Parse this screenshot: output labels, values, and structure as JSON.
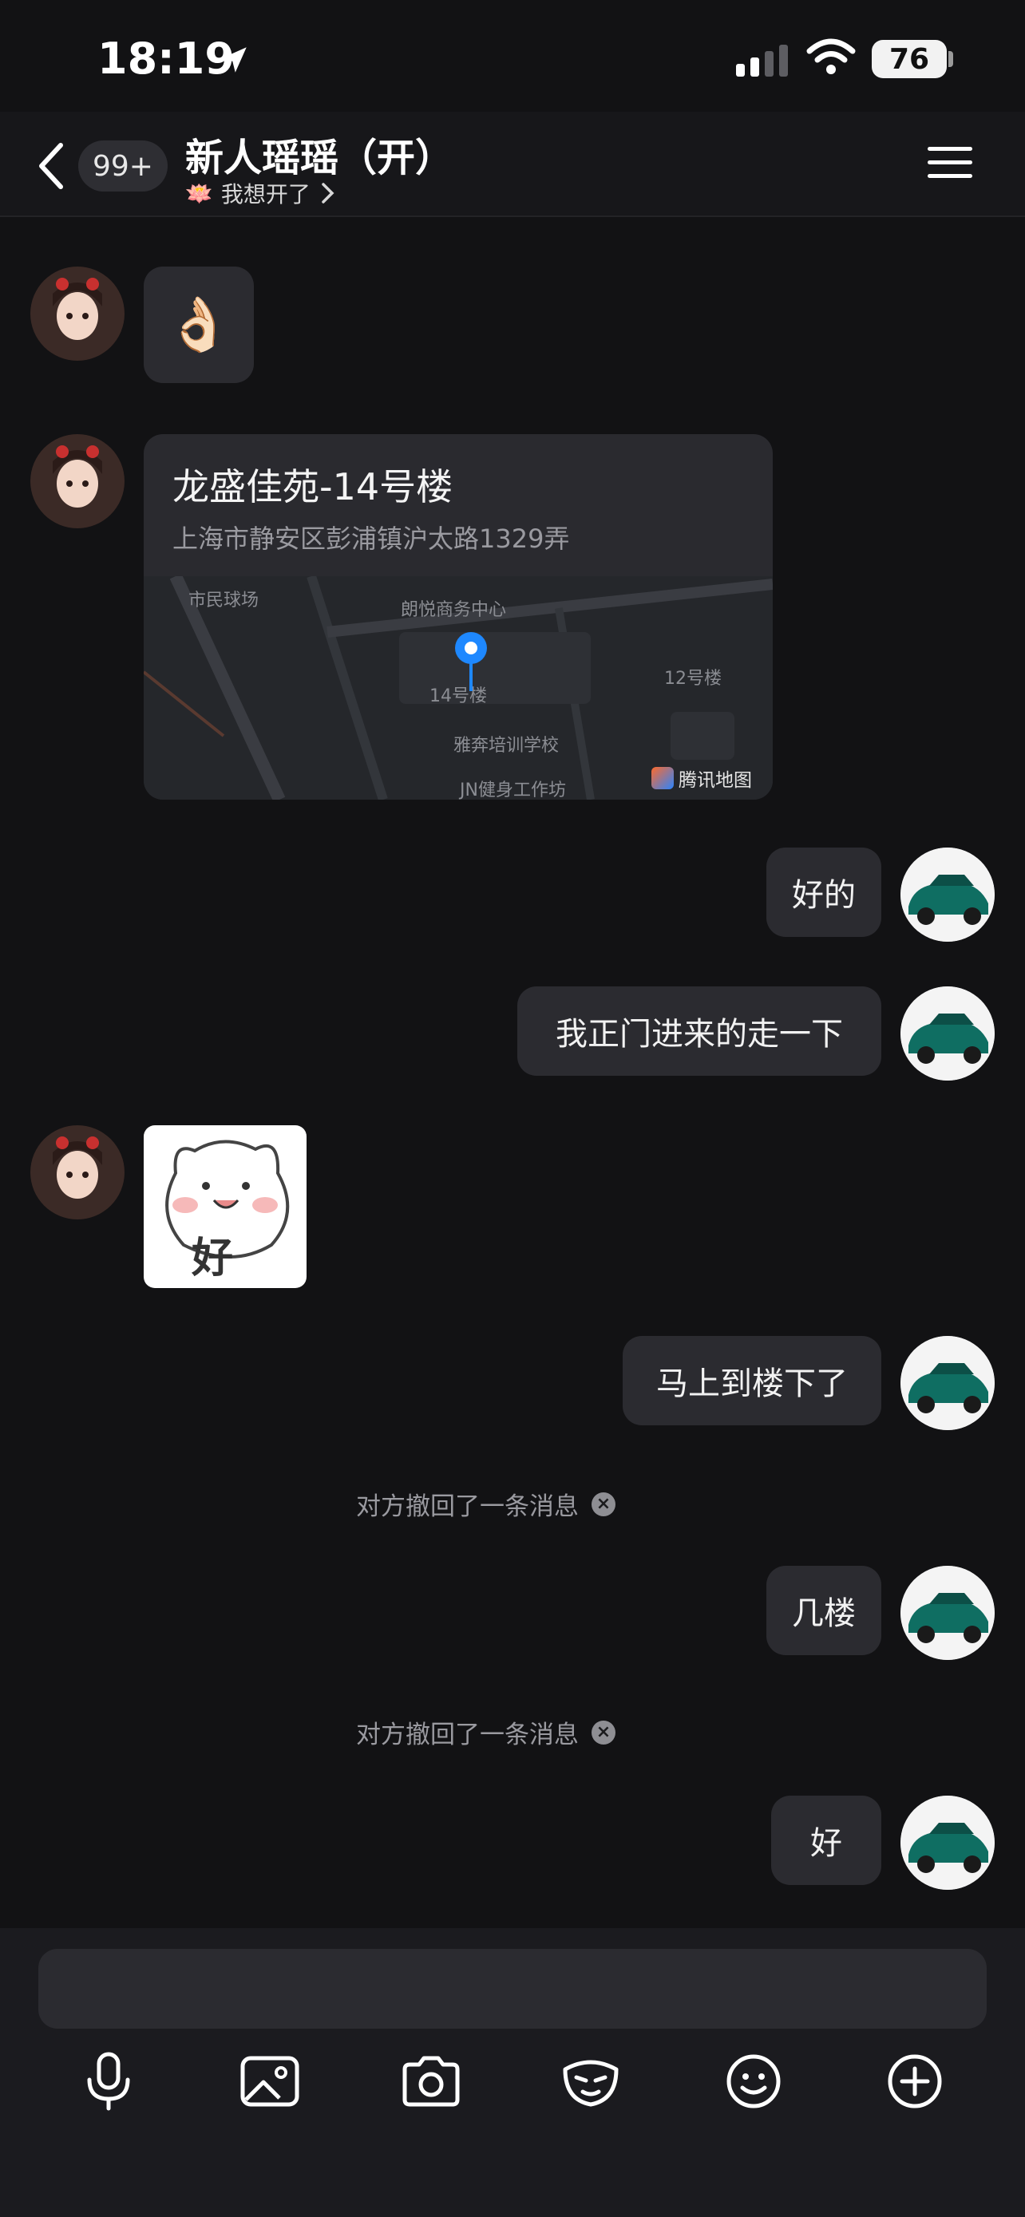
{
  "status_bar": {
    "time": "18:19",
    "battery": "76"
  },
  "header": {
    "unread_count": "99+",
    "title": "新人瑶瑶（开）",
    "subtitle": "我想开了"
  },
  "messages": {
    "emoji": "👌🏻",
    "location": {
      "name": "龙盛佳苑-14号楼",
      "address": "上海市静安区彭浦镇沪太路1329弄",
      "map_labels": {
        "plaza": "市民球场",
        "center": "朗悦商务中心",
        "bldg14": "14号楼",
        "bldg12": "12号楼",
        "school": "雅奔培训学校",
        "gym": "JN健身工作坊",
        "brand": "腾讯地图"
      }
    },
    "m1": "好的",
    "m2": "我正门进来的走一下",
    "sticker_text": "好",
    "m3": "马上到楼下了",
    "recall1": "对方撤回了一条消息",
    "m4": "几楼",
    "recall2": "对方撤回了一条消息",
    "m5": "好"
  },
  "toolbar": {
    "icons": [
      "mic-icon",
      "image-icon",
      "camera-icon",
      "mask-icon",
      "emoji-icon",
      "plus-icon"
    ]
  }
}
